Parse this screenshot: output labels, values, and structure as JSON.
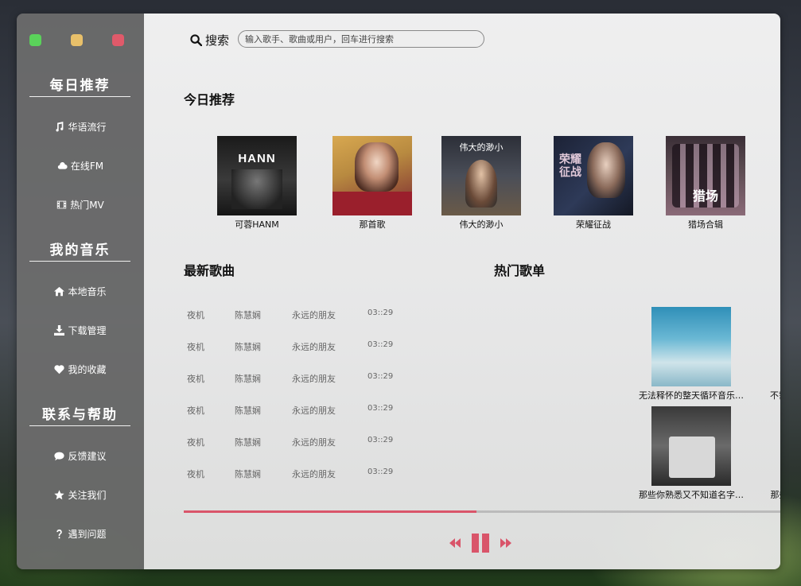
{
  "colors": {
    "accent": "#d9556a",
    "close": "#e05a6a",
    "minimize": "#e8c06a",
    "maximize": "#5ad25a"
  },
  "search": {
    "label": "搜索",
    "placeholder": "输入歌手、歌曲或用户，回车进行搜索"
  },
  "sidebar": {
    "sections": [
      {
        "title": "每日推荐",
        "items": [
          {
            "label": "华语流行",
            "icon": "music-note-icon"
          },
          {
            "label": "在线FM",
            "icon": "cloud-icon"
          },
          {
            "label": "热门MV",
            "icon": "film-icon"
          }
        ]
      },
      {
        "title": "我的音乐",
        "items": [
          {
            "label": "本地音乐",
            "icon": "home-icon"
          },
          {
            "label": "下载管理",
            "icon": "download-icon"
          },
          {
            "label": "我的收藏",
            "icon": "heart-icon"
          }
        ]
      },
      {
        "title": "联系与帮助",
        "items": [
          {
            "label": "反馈建议",
            "icon": "comment-icon"
          },
          {
            "label": "关注我们",
            "icon": "star-icon"
          },
          {
            "label": "遇到问题",
            "icon": "question-icon"
          }
        ]
      }
    ]
  },
  "today": {
    "title": "今日推荐",
    "albums": [
      {
        "name": "可蓉HANM",
        "cover_text": "HANN"
      },
      {
        "name": "那首歌",
        "cover_text": ""
      },
      {
        "name": "伟大的渺小",
        "cover_text": "伟大的渺小"
      },
      {
        "name": "荣耀征战",
        "cover_text": "荣耀征战"
      },
      {
        "name": "猎场合辑",
        "cover_text": "猎场"
      }
    ]
  },
  "latest": {
    "title": "最新歌曲",
    "songs": [
      {
        "title": "夜机",
        "artist": "陈慧娴",
        "album": "永远的朋友",
        "duration": "03::29"
      },
      {
        "title": "夜机",
        "artist": "陈慧娴",
        "album": "永远的朋友",
        "duration": "03::29"
      },
      {
        "title": "夜机",
        "artist": "陈慧娴",
        "album": "永远的朋友",
        "duration": "03::29"
      },
      {
        "title": "夜机",
        "artist": "陈慧娴",
        "album": "永远的朋友",
        "duration": "03::29"
      },
      {
        "title": "夜机",
        "artist": "陈慧娴",
        "album": "永远的朋友",
        "duration": "03::29"
      },
      {
        "title": "夜机",
        "artist": "陈慧娴",
        "album": "永远的朋友",
        "duration": "03::29"
      }
    ]
  },
  "hot": {
    "title": "热门歌单",
    "playlists": [
      {
        "name": "无法释怀的整天循环音乐…"
      },
      {
        "name": "不需要歌词, 也可以打动你的心"
      },
      {
        "name": "那些你熟悉又不知道名字…"
      },
      {
        "name": "那些只听前奏就中毒的英文歌"
      }
    ]
  },
  "player": {
    "progress": 0.49
  }
}
